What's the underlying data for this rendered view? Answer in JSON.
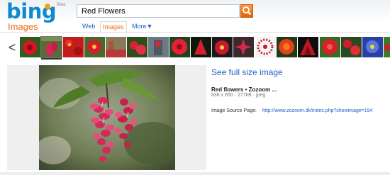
{
  "header": {
    "logo_text": "bing",
    "beta_text": "Beta",
    "search": {
      "value": "Red Flowers",
      "placeholder": ""
    },
    "search_button_icon": "search-icon"
  },
  "nav": {
    "section_title": "Images",
    "tabs": [
      {
        "label": "Web",
        "active": false
      },
      {
        "label": "Images",
        "active": true
      },
      {
        "label": "More▼",
        "active": false
      }
    ]
  },
  "thumbnails": {
    "prev_glyph": "<",
    "count": 18,
    "selected_index": 1
  },
  "detail": {
    "fullsize_link": "See full size image",
    "title": "Red flowers • Zozoom ...",
    "meta": "838 x 650 · 277kB · jpeg",
    "source_label": "Image Source Page:",
    "source_url": "http://www.zozoom.dk/index.php?showimage=194"
  },
  "colors": {
    "brand_blue": "#0f8acd",
    "accent_orange": "#e96a12",
    "link_blue": "#1e62c3"
  }
}
